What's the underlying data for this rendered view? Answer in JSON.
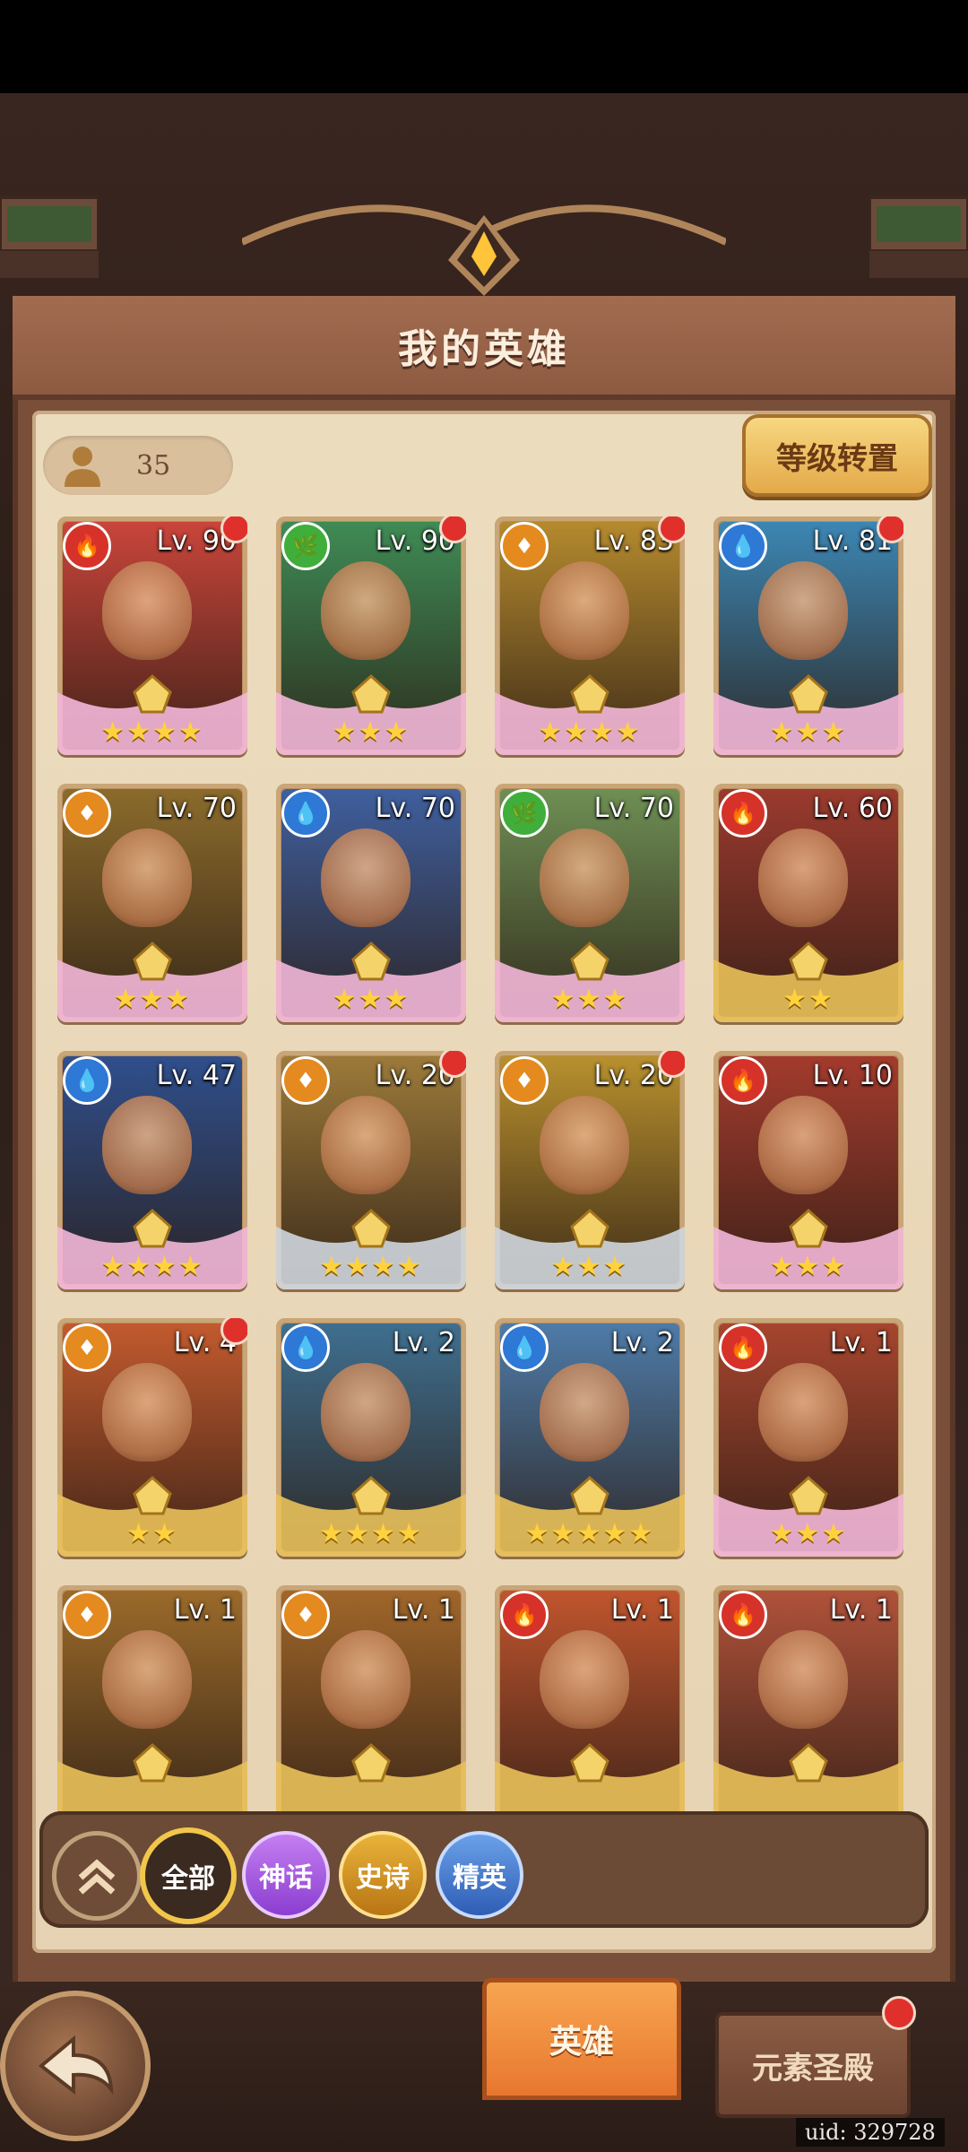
{
  "page": {
    "title": "我的英雄"
  },
  "hero_count": "35",
  "reset_button": "等级转置",
  "colors": {
    "fire": "#d6322a",
    "water": "#2e78d6",
    "nature": "#3fae3a",
    "light": "#e58a1f",
    "wings_pink": "#f3b7d8",
    "wings_gold": "#e9c15a",
    "wings_silver": "#cfd6dd"
  },
  "heroes": [
    {
      "level": "Lv. 90",
      "element": "fire",
      "stars": "★★★★",
      "frame": "pink",
      "notify": true,
      "bg": "#c9453a"
    },
    {
      "level": "Lv. 90",
      "element": "nature",
      "stars": "★★★",
      "frame": "pink",
      "notify": true,
      "bg": "#3f8b55"
    },
    {
      "level": "Lv. 83",
      "element": "light",
      "stars": "★★★★",
      "frame": "pink",
      "notify": true,
      "bg": "#b58a2e"
    },
    {
      "level": "Lv. 81",
      "element": "water",
      "stars": "★★★",
      "frame": "pink",
      "notify": true,
      "bg": "#3c86b3"
    },
    {
      "level": "Lv. 70",
      "element": "light",
      "stars": "★★★",
      "frame": "pink",
      "notify": false,
      "bg": "#8b6b2c"
    },
    {
      "level": "Lv. 70",
      "element": "water",
      "stars": "★★★",
      "frame": "pink",
      "notify": false,
      "bg": "#3f5f9e"
    },
    {
      "level": "Lv. 70",
      "element": "nature",
      "stars": "★★★",
      "frame": "pink",
      "notify": false,
      "bg": "#6e8f54"
    },
    {
      "level": "Lv. 60",
      "element": "fire",
      "stars": "★★",
      "frame": "gold",
      "notify": false,
      "bg": "#9b3a2e"
    },
    {
      "level": "Lv. 47",
      "element": "water",
      "stars": "★★★★",
      "frame": "pink",
      "notify": false,
      "bg": "#2f4f8c"
    },
    {
      "level": "Lv. 20",
      "element": "light",
      "stars": "★★★★",
      "frame": "silver",
      "notify": true,
      "bg": "#9c7a3a"
    },
    {
      "level": "Lv. 20",
      "element": "light",
      "stars": "★★★",
      "frame": "silver",
      "notify": true,
      "bg": "#b8902e"
    },
    {
      "level": "Lv. 10",
      "element": "fire",
      "stars": "★★★",
      "frame": "pink",
      "notify": false,
      "bg": "#a33b2d"
    },
    {
      "level": "Lv. 4",
      "element": "light",
      "stars": "★★",
      "frame": "gold",
      "notify": true,
      "bg": "#c25a2e"
    },
    {
      "level": "Lv. 2",
      "element": "water",
      "stars": "★★★★",
      "frame": "gold",
      "notify": false,
      "bg": "#3f6f8f"
    },
    {
      "level": "Lv. 2",
      "element": "water",
      "stars": "★★★★★",
      "frame": "gold",
      "notify": false,
      "bg": "#4e7ba8"
    },
    {
      "level": "Lv. 1",
      "element": "fire",
      "stars": "★★★",
      "frame": "pink",
      "notify": false,
      "bg": "#a6452e"
    },
    {
      "level": "Lv. 1",
      "element": "light",
      "stars": "",
      "frame": "gold",
      "notify": false,
      "bg": "#9b6a2a"
    },
    {
      "level": "Lv. 1",
      "element": "light",
      "stars": "",
      "frame": "gold",
      "notify": false,
      "bg": "#a0662a"
    },
    {
      "level": "Lv. 1",
      "element": "fire",
      "stars": "",
      "frame": "gold",
      "notify": false,
      "bg": "#c0552e"
    },
    {
      "level": "Lv. 1",
      "element": "fire",
      "stars": "",
      "frame": "gold",
      "notify": false,
      "bg": "#b0523a"
    }
  ],
  "filters": {
    "all": "全部",
    "myth": "神话",
    "epic": "史诗",
    "elite": "精英"
  },
  "tabs": {
    "hero": "英雄",
    "temple": "元素圣殿"
  },
  "uid": "uid: 329728"
}
